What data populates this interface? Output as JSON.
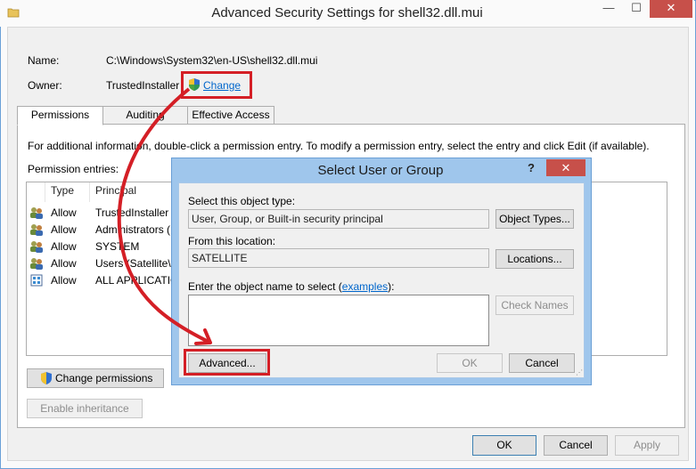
{
  "window": {
    "title": "Advanced Security Settings for shell32.dll.mui",
    "min_glyph": "—",
    "max_glyph": "☐",
    "close_glyph": "✕"
  },
  "info": {
    "name_label": "Name:",
    "name_value": "C:\\Windows\\System32\\en-US\\shell32.dll.mui",
    "owner_label": "Owner:",
    "owner_value": "TrustedInstaller",
    "change_link": "Change"
  },
  "tabs": [
    {
      "label": "Permissions"
    },
    {
      "label": "Auditing"
    },
    {
      "label": "Effective Access"
    }
  ],
  "permissions": {
    "instructions": "For additional information, double-click a permission entry. To modify a permission entry, select the entry and click Edit (if available).",
    "entries_label": "Permission entries:",
    "columns": [
      "Type",
      "Principal"
    ],
    "rows": [
      {
        "type": "Allow",
        "principal": "TrustedInstaller",
        "icon": "users-icon"
      },
      {
        "type": "Allow",
        "principal": "Administrators (",
        "icon": "users-icon"
      },
      {
        "type": "Allow",
        "principal": "SYSTEM",
        "icon": "users-icon"
      },
      {
        "type": "Allow",
        "principal": "Users (Satellite\\U",
        "icon": "users-icon"
      },
      {
        "type": "Allow",
        "principal": "ALL APPLICATIO",
        "icon": "app-package-icon"
      }
    ],
    "change_permissions": "Change permissions",
    "enable_inheritance": "Enable inheritance"
  },
  "footer": {
    "ok": "OK",
    "cancel": "Cancel",
    "apply": "Apply"
  },
  "dialog": {
    "title": "Select User or Group",
    "help_glyph": "?",
    "close_glyph": "✕",
    "object_type_label": "Select this object type:",
    "object_type_value": "User, Group, or Built-in security principal",
    "object_types_button": "Object Types...",
    "location_label": "From this location:",
    "location_value": "SATELLITE",
    "locations_button": "Locations...",
    "enter_name_prefix": "Enter the object name to select (",
    "examples_link": "examples",
    "enter_name_suffix": "):",
    "name_input_value": "",
    "check_names_button": "Check Names",
    "advanced_button": "Advanced...",
    "ok_button": "OK",
    "cancel_button": "Cancel"
  },
  "annotation": {
    "highlight_color": "#d41f26"
  }
}
